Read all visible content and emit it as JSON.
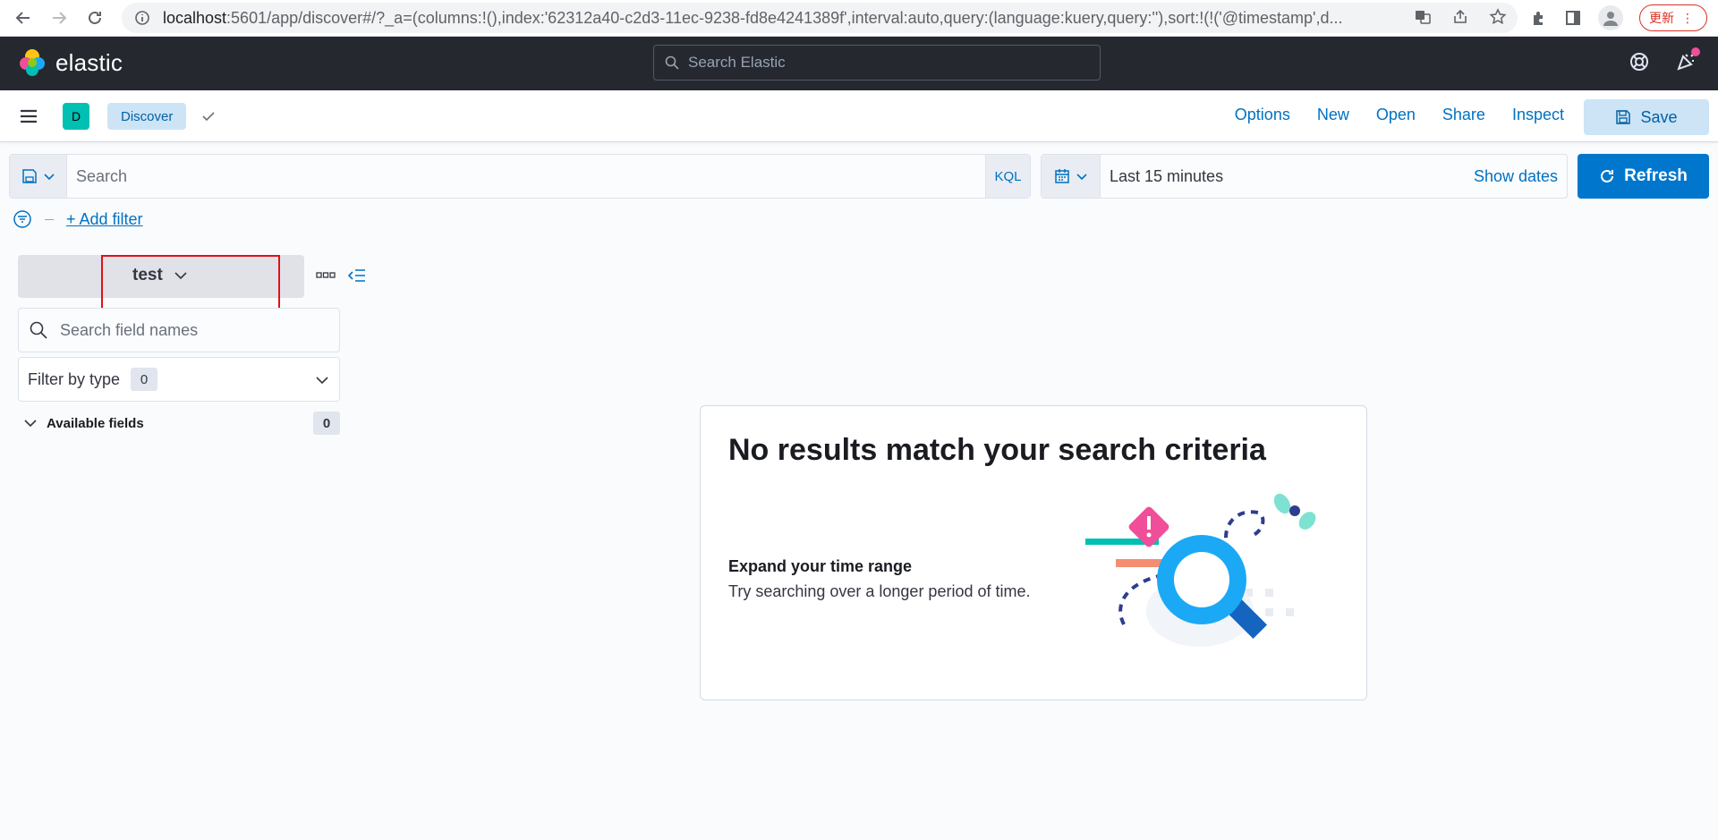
{
  "browser": {
    "url_host": "localhost",
    "url_rest": ":5601/app/discover#/?_a=(columns:!(),index:'62312a40-c2d3-11ec-9238-fd8e4241389f',interval:auto,query:(language:kuery,query:''),sort:!(!('@timestamp',d...",
    "update_label": "更新"
  },
  "header": {
    "logo_text": "elastic",
    "search_placeholder": "Search Elastic"
  },
  "app_bar": {
    "space_initial": "D",
    "breadcrumb": "Discover",
    "links": [
      "Options",
      "New",
      "Open",
      "Share",
      "Inspect"
    ],
    "save_label": "Save"
  },
  "query_bar": {
    "placeholder": "Search",
    "language": "KQL",
    "date_range": "Last 15 minutes",
    "show_dates": "Show dates",
    "refresh_label": "Refresh"
  },
  "filters": {
    "add_filter": "+ Add filter"
  },
  "sidebar": {
    "index_pattern": "test",
    "field_search_placeholder": "Search field names",
    "filter_by_type": "Filter by type",
    "filter_by_type_count": "0",
    "available_fields": "Available fields",
    "available_fields_count": "0"
  },
  "no_results": {
    "title": "No results match your search criteria",
    "subtitle": "Expand your time range",
    "description": "Try searching over a longer period of time."
  },
  "colors": {
    "header_bg": "#25282f",
    "primary": "#0077cc",
    "link": "#0071c2",
    "space_avatar": "#00bfb3",
    "highlight": "#e0101a"
  }
}
